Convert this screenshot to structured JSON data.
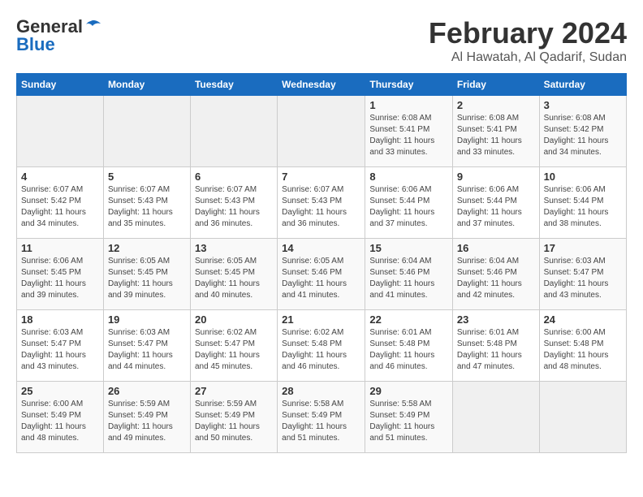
{
  "header": {
    "logo_general": "General",
    "logo_blue": "Blue",
    "month": "February 2024",
    "location": "Al Hawatah, Al Qadarif, Sudan"
  },
  "weekdays": [
    "Sunday",
    "Monday",
    "Tuesday",
    "Wednesday",
    "Thursday",
    "Friday",
    "Saturday"
  ],
  "weeks": [
    [
      {
        "day": "",
        "info": ""
      },
      {
        "day": "",
        "info": ""
      },
      {
        "day": "",
        "info": ""
      },
      {
        "day": "",
        "info": ""
      },
      {
        "day": "1",
        "info": "Sunrise: 6:08 AM\nSunset: 5:41 PM\nDaylight: 11 hours\nand 33 minutes."
      },
      {
        "day": "2",
        "info": "Sunrise: 6:08 AM\nSunset: 5:41 PM\nDaylight: 11 hours\nand 33 minutes."
      },
      {
        "day": "3",
        "info": "Sunrise: 6:08 AM\nSunset: 5:42 PM\nDaylight: 11 hours\nand 34 minutes."
      }
    ],
    [
      {
        "day": "4",
        "info": "Sunrise: 6:07 AM\nSunset: 5:42 PM\nDaylight: 11 hours\nand 34 minutes."
      },
      {
        "day": "5",
        "info": "Sunrise: 6:07 AM\nSunset: 5:43 PM\nDaylight: 11 hours\nand 35 minutes."
      },
      {
        "day": "6",
        "info": "Sunrise: 6:07 AM\nSunset: 5:43 PM\nDaylight: 11 hours\nand 36 minutes."
      },
      {
        "day": "7",
        "info": "Sunrise: 6:07 AM\nSunset: 5:43 PM\nDaylight: 11 hours\nand 36 minutes."
      },
      {
        "day": "8",
        "info": "Sunrise: 6:06 AM\nSunset: 5:44 PM\nDaylight: 11 hours\nand 37 minutes."
      },
      {
        "day": "9",
        "info": "Sunrise: 6:06 AM\nSunset: 5:44 PM\nDaylight: 11 hours\nand 37 minutes."
      },
      {
        "day": "10",
        "info": "Sunrise: 6:06 AM\nSunset: 5:44 PM\nDaylight: 11 hours\nand 38 minutes."
      }
    ],
    [
      {
        "day": "11",
        "info": "Sunrise: 6:06 AM\nSunset: 5:45 PM\nDaylight: 11 hours\nand 39 minutes."
      },
      {
        "day": "12",
        "info": "Sunrise: 6:05 AM\nSunset: 5:45 PM\nDaylight: 11 hours\nand 39 minutes."
      },
      {
        "day": "13",
        "info": "Sunrise: 6:05 AM\nSunset: 5:45 PM\nDaylight: 11 hours\nand 40 minutes."
      },
      {
        "day": "14",
        "info": "Sunrise: 6:05 AM\nSunset: 5:46 PM\nDaylight: 11 hours\nand 41 minutes."
      },
      {
        "day": "15",
        "info": "Sunrise: 6:04 AM\nSunset: 5:46 PM\nDaylight: 11 hours\nand 41 minutes."
      },
      {
        "day": "16",
        "info": "Sunrise: 6:04 AM\nSunset: 5:46 PM\nDaylight: 11 hours\nand 42 minutes."
      },
      {
        "day": "17",
        "info": "Sunrise: 6:03 AM\nSunset: 5:47 PM\nDaylight: 11 hours\nand 43 minutes."
      }
    ],
    [
      {
        "day": "18",
        "info": "Sunrise: 6:03 AM\nSunset: 5:47 PM\nDaylight: 11 hours\nand 43 minutes."
      },
      {
        "day": "19",
        "info": "Sunrise: 6:03 AM\nSunset: 5:47 PM\nDaylight: 11 hours\nand 44 minutes."
      },
      {
        "day": "20",
        "info": "Sunrise: 6:02 AM\nSunset: 5:47 PM\nDaylight: 11 hours\nand 45 minutes."
      },
      {
        "day": "21",
        "info": "Sunrise: 6:02 AM\nSunset: 5:48 PM\nDaylight: 11 hours\nand 46 minutes."
      },
      {
        "day": "22",
        "info": "Sunrise: 6:01 AM\nSunset: 5:48 PM\nDaylight: 11 hours\nand 46 minutes."
      },
      {
        "day": "23",
        "info": "Sunrise: 6:01 AM\nSunset: 5:48 PM\nDaylight: 11 hours\nand 47 minutes."
      },
      {
        "day": "24",
        "info": "Sunrise: 6:00 AM\nSunset: 5:48 PM\nDaylight: 11 hours\nand 48 minutes."
      }
    ],
    [
      {
        "day": "25",
        "info": "Sunrise: 6:00 AM\nSunset: 5:49 PM\nDaylight: 11 hours\nand 48 minutes."
      },
      {
        "day": "26",
        "info": "Sunrise: 5:59 AM\nSunset: 5:49 PM\nDaylight: 11 hours\nand 49 minutes."
      },
      {
        "day": "27",
        "info": "Sunrise: 5:59 AM\nSunset: 5:49 PM\nDaylight: 11 hours\nand 50 minutes."
      },
      {
        "day": "28",
        "info": "Sunrise: 5:58 AM\nSunset: 5:49 PM\nDaylight: 11 hours\nand 51 minutes."
      },
      {
        "day": "29",
        "info": "Sunrise: 5:58 AM\nSunset: 5:49 PM\nDaylight: 11 hours\nand 51 minutes."
      },
      {
        "day": "",
        "info": ""
      },
      {
        "day": "",
        "info": ""
      }
    ]
  ]
}
